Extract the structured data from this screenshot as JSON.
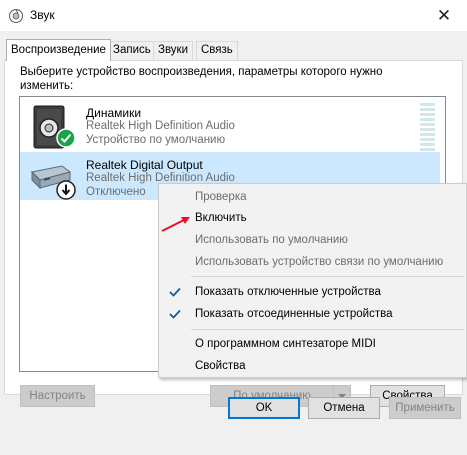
{
  "window": {
    "title": "Звук",
    "close_glyph": "✕"
  },
  "tabs": [
    {
      "label": "Воспроизведение",
      "active": true
    },
    {
      "label": "Запись",
      "active": false
    },
    {
      "label": "Звуки",
      "active": false
    },
    {
      "label": "Связь",
      "active": false
    }
  ],
  "instruction": "Выберите устройство воспроизведения, параметры которого нужно изменить:",
  "devices": [
    {
      "name": "Динамики",
      "driver": "Realtek High Definition Audio",
      "status": "Устройство по умолчанию",
      "icon": "speaker-icon",
      "badge": "default-check-badge-icon"
    },
    {
      "name": "Realtek Digital Output",
      "driver": "Realtek High Definition Audio",
      "status": "Отключено",
      "icon": "digital-output-icon",
      "badge": "disabled-arrow-badge-icon",
      "selected": true
    }
  ],
  "context_menu": {
    "items": [
      {
        "label": "Проверка",
        "enabled": false
      },
      {
        "label": "Включить",
        "enabled": true
      },
      {
        "label": "Использовать по умолчанию",
        "enabled": false
      },
      {
        "label": "Использовать устройство связи по умолчанию",
        "enabled": false
      },
      {
        "label": "Показать отключенные устройства",
        "enabled": true,
        "checked": true
      },
      {
        "label": "Показать отсоединенные устройства",
        "enabled": true,
        "checked": true
      },
      {
        "label": "О программном синтезаторе MIDI",
        "enabled": true
      },
      {
        "label": "Свойства",
        "enabled": true
      }
    ]
  },
  "buttons": {
    "configure": "Настроить",
    "set_default": "По умолчанию",
    "properties": "Свойства",
    "ok": "OK",
    "cancel": "Отмена",
    "apply": "Применить"
  },
  "colors": {
    "selection": "#cce8ff",
    "accent": "#0078d7",
    "annotation_arrow": "#e81123"
  }
}
